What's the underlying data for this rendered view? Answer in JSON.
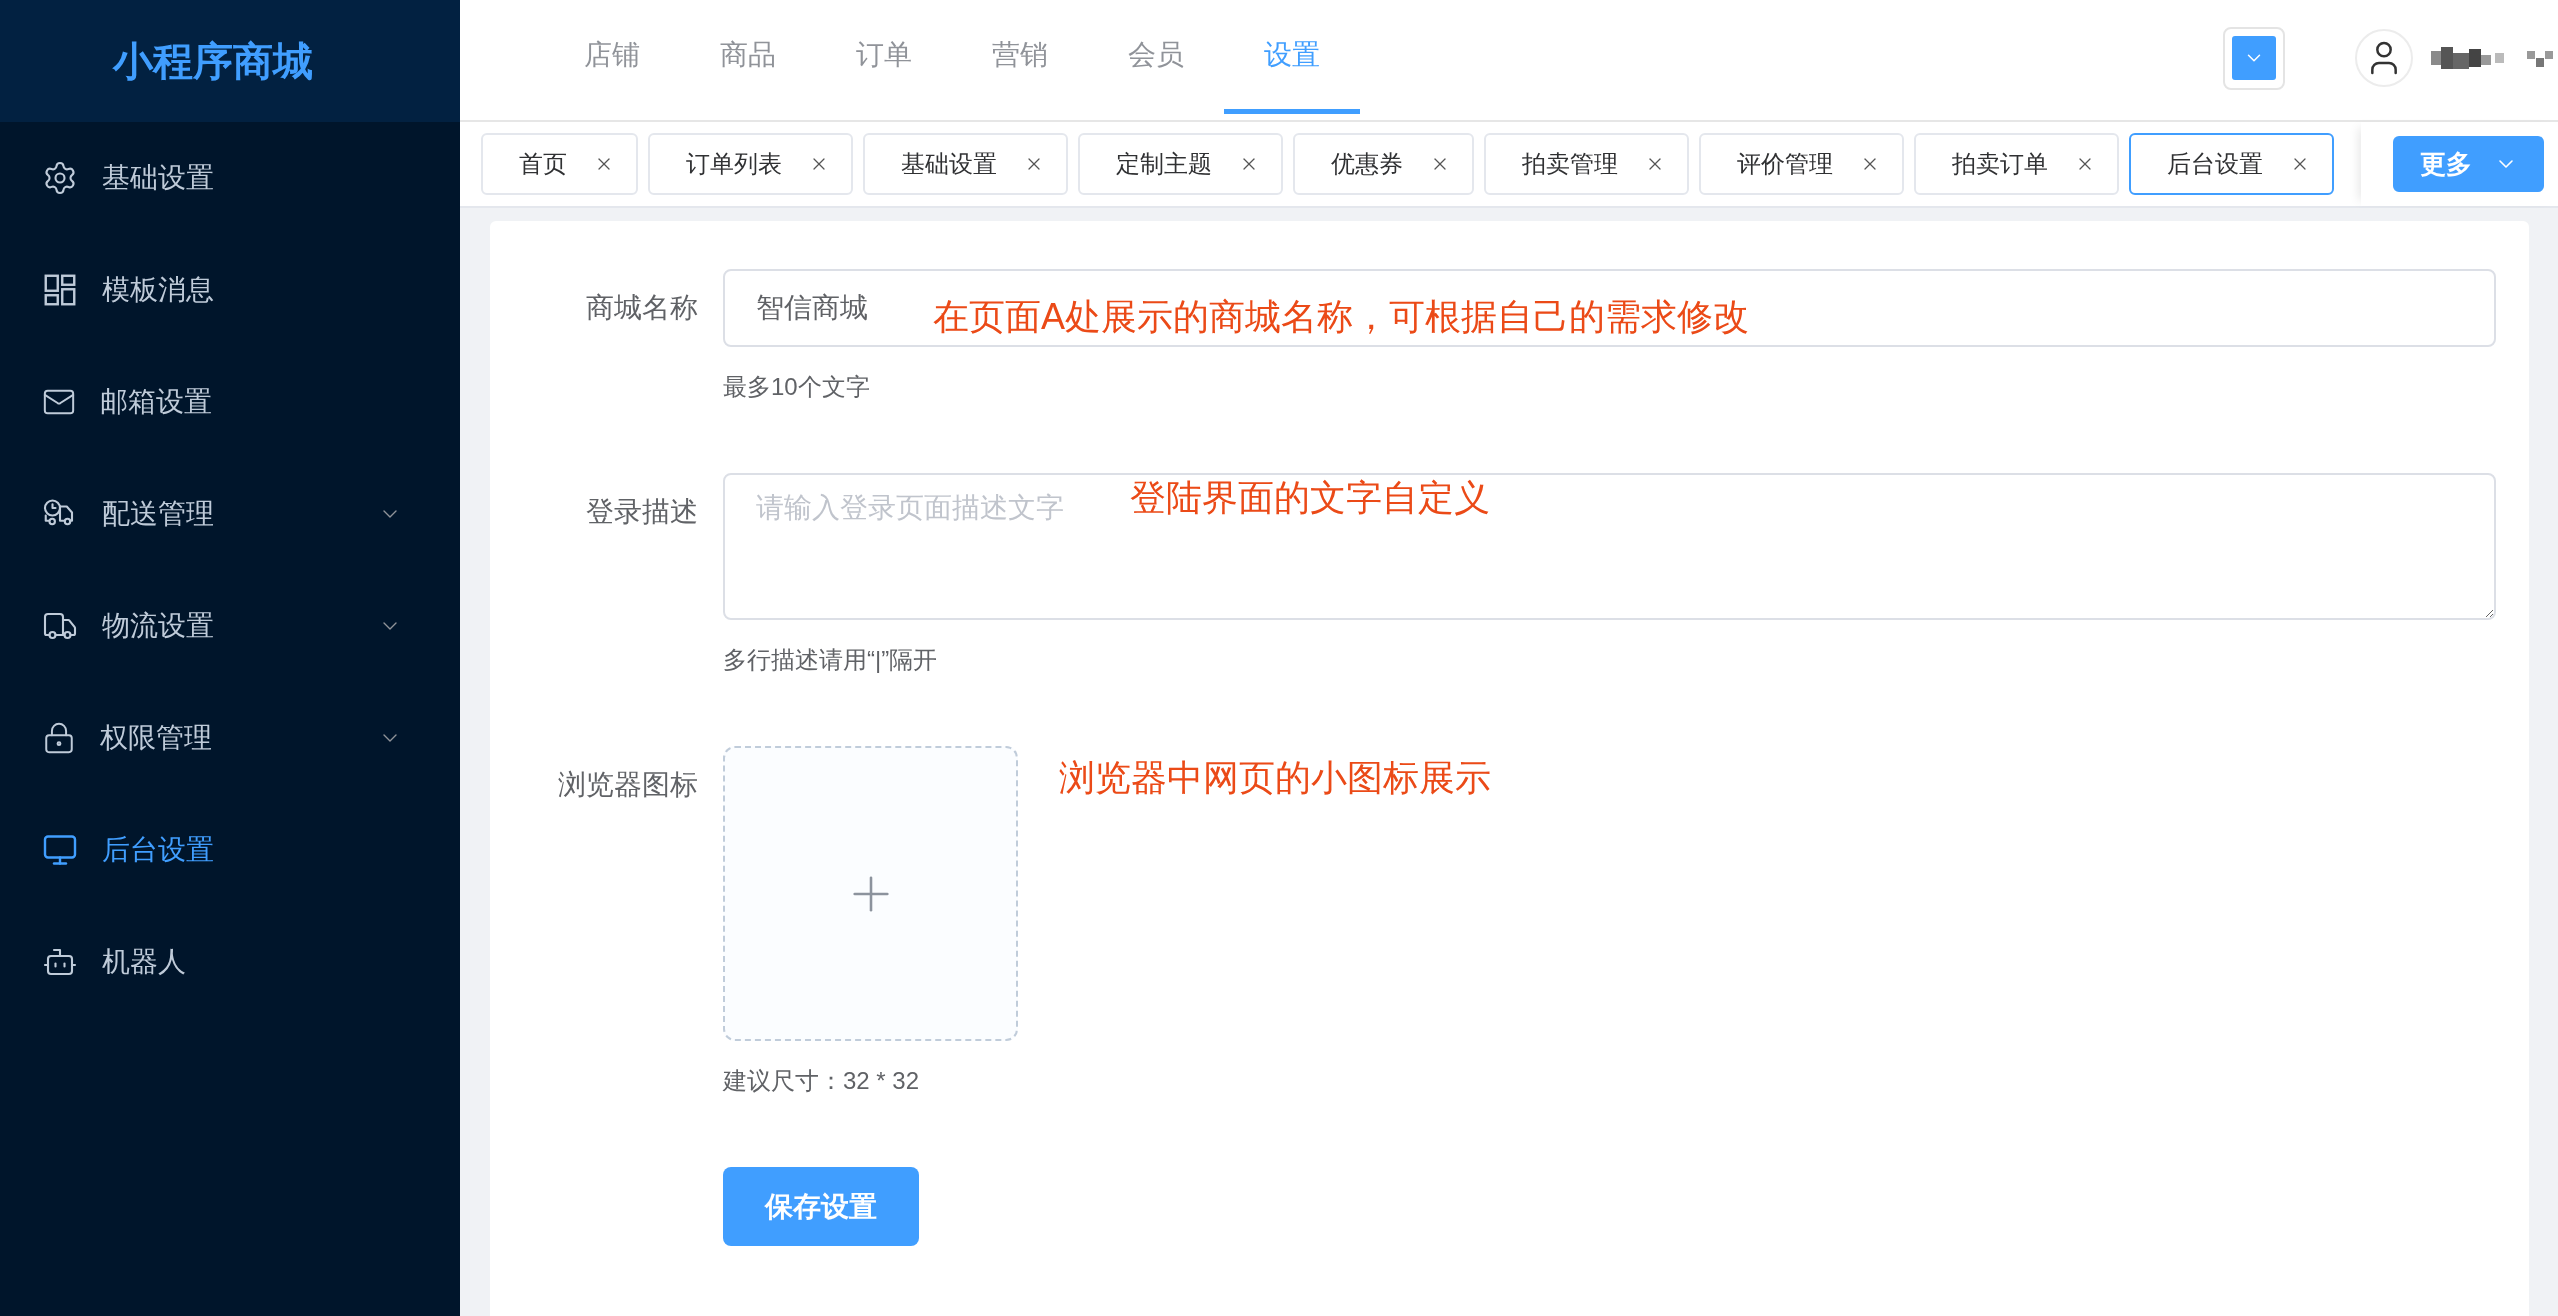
{
  "sidebar": {
    "logo": "小程序商城",
    "items": [
      {
        "label": "基础设置",
        "selected": false,
        "submenu": false
      },
      {
        "label": "模板消息",
        "selected": false,
        "submenu": false
      },
      {
        "label": "邮箱设置",
        "selected": false,
        "submenu": false
      },
      {
        "label": "配送管理",
        "selected": false,
        "submenu": true
      },
      {
        "label": "物流设置",
        "selected": false,
        "submenu": true
      },
      {
        "label": "权限管理",
        "selected": false,
        "submenu": true
      },
      {
        "label": "后台设置",
        "selected": true,
        "submenu": false
      },
      {
        "label": "机器人",
        "selected": false,
        "submenu": false
      }
    ]
  },
  "top_nav": {
    "items": [
      {
        "label": "店铺",
        "selected": false
      },
      {
        "label": "商品",
        "selected": false
      },
      {
        "label": "订单",
        "selected": false
      },
      {
        "label": "营销",
        "selected": false
      },
      {
        "label": "会员",
        "selected": false
      },
      {
        "label": "设置",
        "selected": true
      }
    ]
  },
  "tabs": {
    "items": [
      {
        "label": "首页",
        "selected": false
      },
      {
        "label": "订单列表",
        "selected": false
      },
      {
        "label": "基础设置",
        "selected": false
      },
      {
        "label": "定制主题",
        "selected": false
      },
      {
        "label": "优惠券",
        "selected": false
      },
      {
        "label": "拍卖管理",
        "selected": false
      },
      {
        "label": "评价管理",
        "selected": false
      },
      {
        "label": "拍卖订单",
        "selected": false
      },
      {
        "label": "后台设置",
        "selected": true
      }
    ],
    "more_button": "更多"
  },
  "form": {
    "fields": [
      {
        "kind": "input",
        "label": "商城名称",
        "value": "智信商城",
        "annotation": "在页面A处展示的商城名称，可根据自己的需求修改",
        "hint": "最多10个文字"
      },
      {
        "kind": "textarea",
        "label": "登录描述",
        "placeholder": "请输入登录页面描述文字",
        "annotation": "登陆界面的文字自定义",
        "hint": "多行描述请用“|”隔开"
      },
      {
        "kind": "upload",
        "label": "浏览器图标",
        "annotation": "浏览器中网页的小图标展示",
        "hint": "建议尺寸：32 * 32"
      }
    ],
    "submit_button": "保存设置"
  }
}
